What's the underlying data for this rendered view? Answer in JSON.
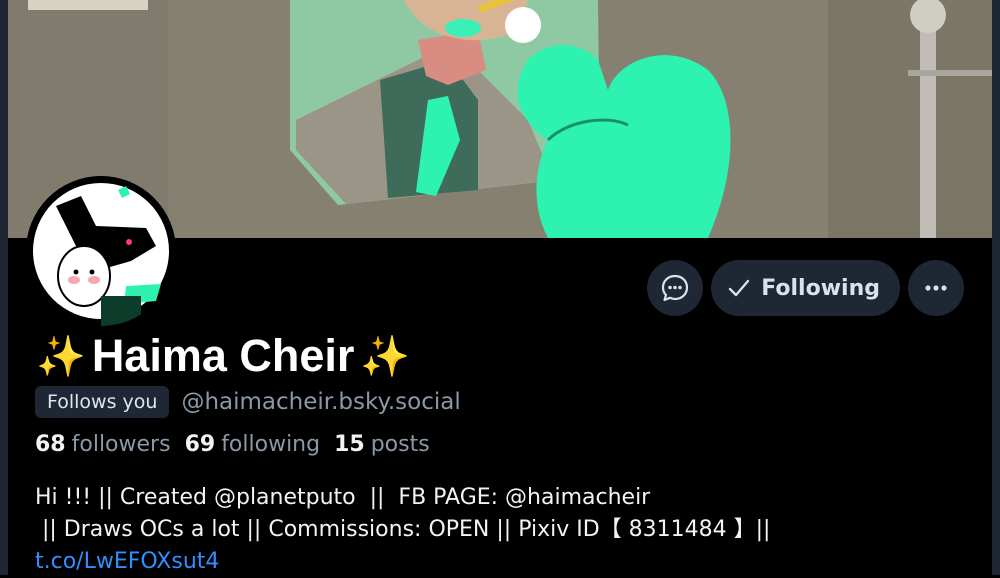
{
  "profile": {
    "display_name": "Haima Cheir",
    "name_emoji": "✨",
    "follows_you_badge": "Follows you",
    "handle": "@haimacheir.bsky.social",
    "followers_count": "68",
    "followers_label": "followers",
    "following_count": "69",
    "following_label": "following",
    "posts_count": "15",
    "posts_label": "posts",
    "bio_line1": "Hi !!! || Created @planetputo  ||  FB PAGE: @haimacheir",
    "bio_line2": " || Draws OCs a lot || Commissions: OPEN || Pixiv ID【 8311484 】||",
    "bio_link": "t.co/LwEFOXsut4"
  },
  "actions": {
    "message_icon": "chat-bubble-icon",
    "following_label": "Following",
    "more_icon": "ellipsis-icon"
  },
  "colors": {
    "background": "#000000",
    "button_bg": "#1e2733",
    "link": "#2f8fff",
    "muted_text": "#8b98a8",
    "sparkle": "#f8c31c",
    "artwork_green": "#2ef2b0"
  }
}
